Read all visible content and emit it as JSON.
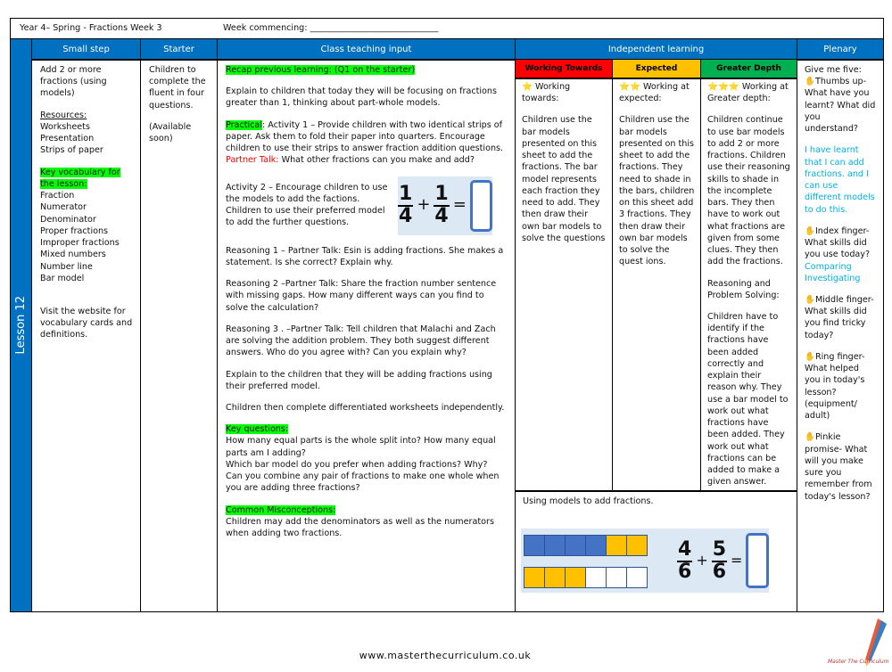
{
  "header": {
    "title": "Year 4– Spring - Fractions Week 3",
    "week_commencing": "Week commencing: ______________________________"
  },
  "lesson_label": "Lesson 12",
  "columns": {
    "small_step": "Small step",
    "starter": "Starter",
    "class_teaching": "Class teaching input",
    "independent": "Independent learning",
    "plenary": "Plenary"
  },
  "small_step": {
    "title": "Add 2 or more fractions (using models)",
    "resources_label": "Resources:",
    "resources": [
      "Worksheets",
      "Presentation",
      "Strips of paper"
    ],
    "vocab_label": "Key vocabulary for the lesson:",
    "vocab": [
      "Fraction",
      "Numerator",
      "Denominator",
      "Proper fractions",
      "Improper fractions",
      "Mixed numbers",
      "Number line",
      "Bar model"
    ],
    "visit": "Visit the website for vocabulary cards and definitions."
  },
  "starter": {
    "text": "Children to complete the fluent in four questions.",
    "available": "(Available soon)"
  },
  "teaching": {
    "recap": "Recap previous learning: (Q1 on the starter)",
    "explain1": "Explain to children that today they will be focusing on fractions greater than 1, thinking about part-whole models.",
    "practical_label": "Practical",
    "practical": ": Activity 1 – Provide children with two identical strips of paper. Ask them to fold their paper into quarters. Encourage children to use their strips to answer fraction addition questions.",
    "partner_label": "Partner Talk:",
    "partner": " What other fractions can you make and add?",
    "activity2": "Activity 2 – Encourage children to use the models to add the factions. Children to use their preferred model to add the further questions.",
    "eq": {
      "n1": "1",
      "d1": "4",
      "op": "+",
      "n2": "1",
      "d2": "4",
      "eq": "="
    },
    "reasoning1": "Reasoning 1 – Partner Talk:  Esin is adding fractions. She makes a statement. Is she correct? Explain why.",
    "reasoning2": "Reasoning 2 –Partner Talk:  Share the fraction number sentence with missing gaps. How many different ways can you find to  solve the calculation?",
    "reasoning3": "Reasoning 3 . –Partner Talk: Tell children that Malachi and Zach are solving the addition problem. They both suggest different answers. Who do you agree with? Can you explain why?",
    "explain2": "Explain to the children that they will be adding fractions using their preferred model.",
    "complete": "Children then complete differentiated worksheets independently.",
    "key_q_label": "Key questions:",
    "key_q": [
      "How many equal parts is the whole split into? How many equal parts am I adding?",
      "Which bar model do you prefer when adding fractions? Why?",
      "Can you combine any pair of fractions to make one whole when you are adding three fractions?"
    ],
    "misc_label": "Common Misconceptions:",
    "misc": "Children may add the denominators as well as the numerators when adding two fractions."
  },
  "independent": {
    "levels": [
      {
        "label": "Working Towards",
        "color": "#ff0000",
        "stars": "⭐",
        "title": "Working towards:",
        "text": "Children use the bar models presented on this sheet to add the fractions. The bar model represents each fraction they need to add. They then draw their own bar models to solve the questions"
      },
      {
        "label": "Expected",
        "color": "#ffc000",
        "stars": "⭐⭐",
        "title": "Working at expected:",
        "text": "Children use the bar models presented on this sheet to add the fractions. They need to shade in the bars, children on this sheet add 3 fractions. They then draw their own bar models to solve the quest ions."
      },
      {
        "label": "Greater Depth",
        "color": "#00b050",
        "stars": "⭐⭐⭐",
        "title": "Working at Greater depth:",
        "text": "Children continue to use bar models to add 2 or more fractions. Children use their reasoning skills to shade in the incomplete bars. They then have to work out what fractions are given from some clues. They then add the fractions.",
        "rps_title": "Reasoning and Problem Solving:",
        "rps": "Children have to identify if the fractions have been added correctly and explain their reason why. They use a bar model to work out what fractions have been added. They work out what fractions can be added to make a given answer."
      }
    ],
    "example": {
      "caption": "Using models to add fractions.",
      "bar1": [
        "b",
        "b",
        "b",
        "b",
        "y",
        "y"
      ],
      "bar2": [
        "y",
        "y",
        "y",
        "w",
        "w",
        "w"
      ],
      "n1": "4",
      "d1": "6",
      "op": "+",
      "n2": "5",
      "d2": "6",
      "eq": "="
    }
  },
  "plenary": {
    "intro": "Give me five:",
    "thumb": "Thumbs up- What have you learnt? What did you understand?",
    "learnt": "I have learnt that I can add fractions. and I can use different models to do this.",
    "index": "Index finger- What skills did you use today?",
    "skills": [
      "Comparing",
      "Investigating"
    ],
    "middle": "Middle finger- What skills did you find tricky today?",
    "ring": "Ring finger- What helped you in today's lesson? (equipment/ adult)",
    "pinkie": "Pinkie promise- What will you make sure you remember from today's lesson?",
    "hand_icon": "✋"
  },
  "footer": {
    "url": "www.masterthecurriculum.co.uk",
    "logo_text": "Master The Curriculum"
  }
}
